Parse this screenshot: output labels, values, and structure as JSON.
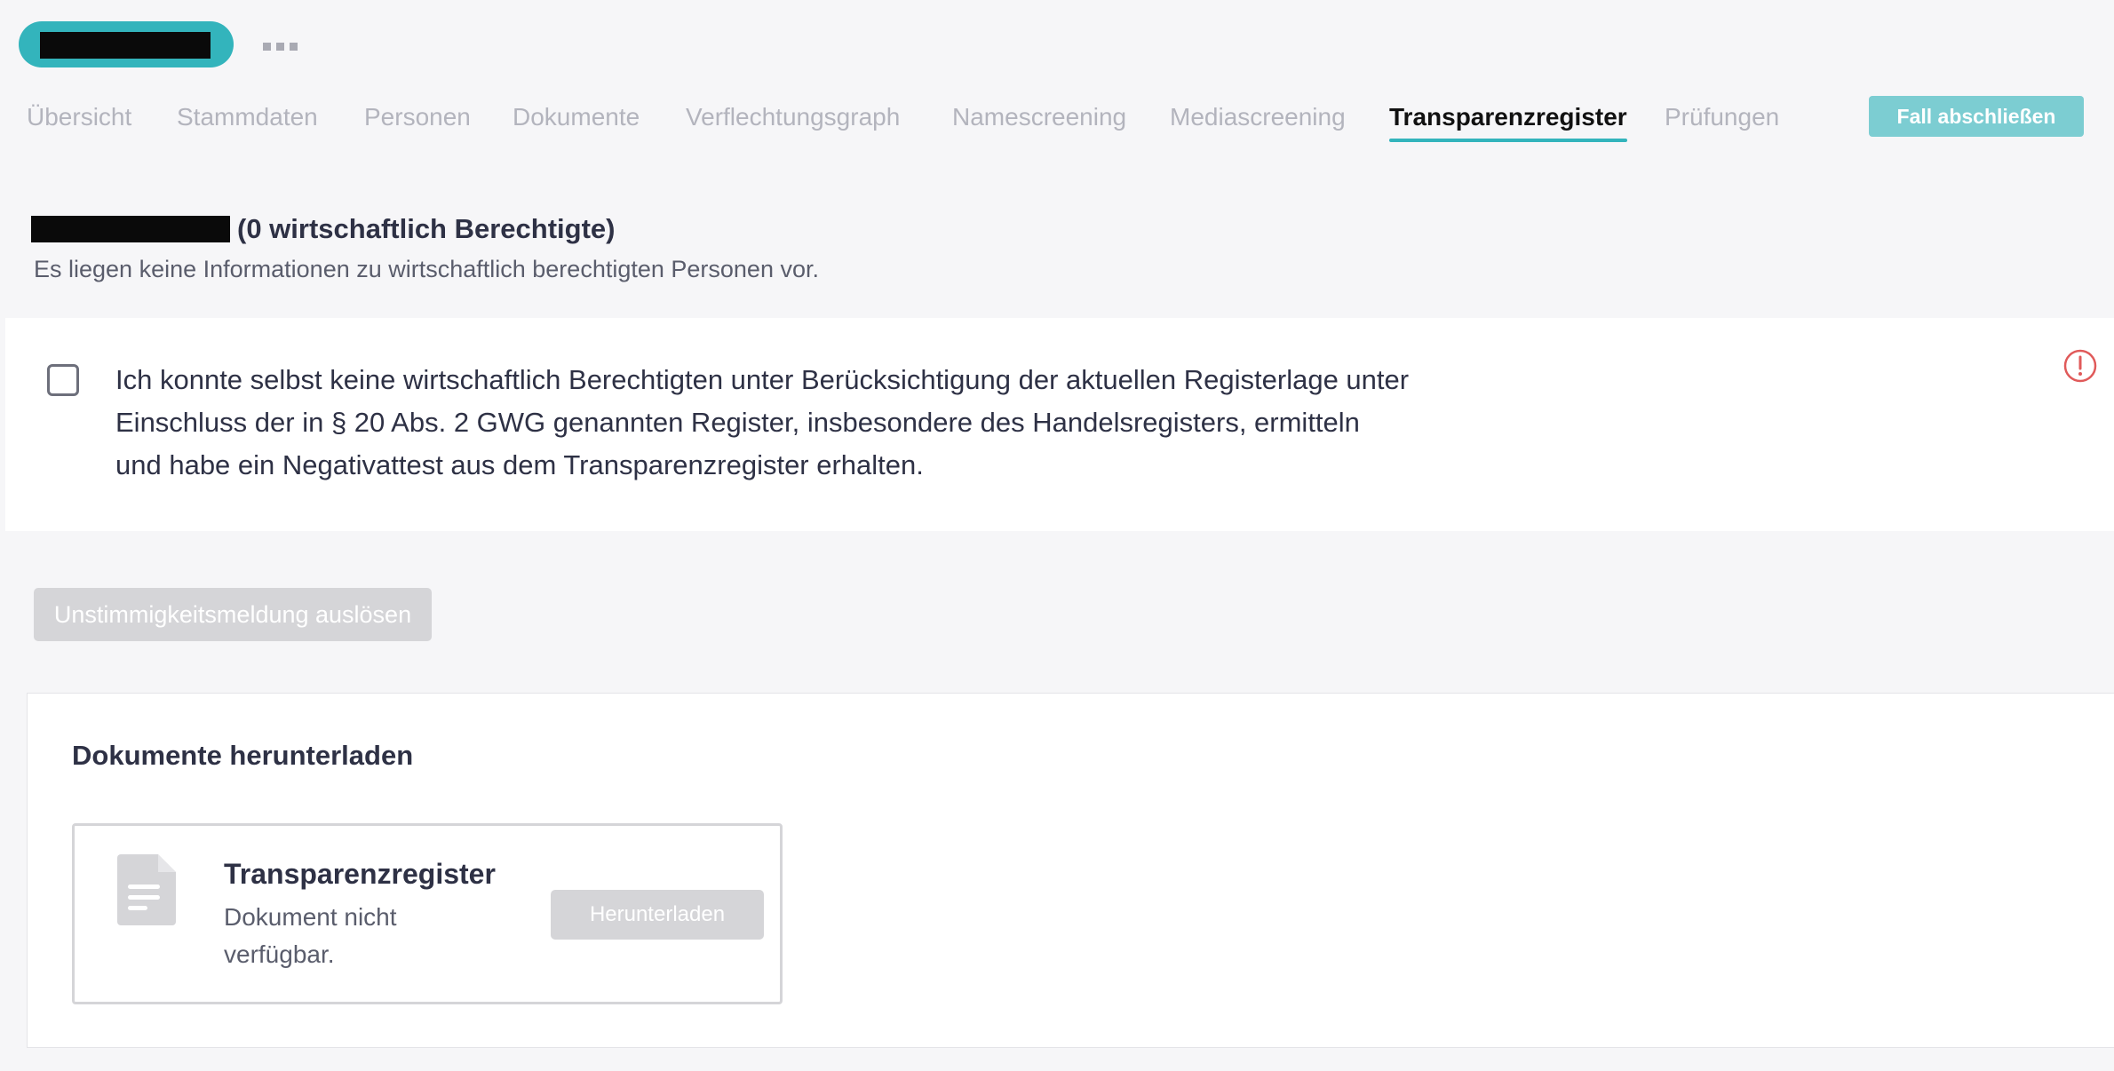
{
  "header": {
    "case_name_redacted": "",
    "more_label": "..."
  },
  "tabs": [
    {
      "label": "Übersicht",
      "active": false
    },
    {
      "label": "Stammdaten",
      "active": false
    },
    {
      "label": "Personen",
      "active": false
    },
    {
      "label": "Dokumente",
      "active": false
    },
    {
      "label": "Verflechtungsgraph",
      "active": false
    },
    {
      "label": "Namescreening",
      "active": false
    },
    {
      "label": "Mediascreening",
      "active": false
    },
    {
      "label": "Transparenzregister",
      "active": true
    },
    {
      "label": "Prüfungen",
      "active": false
    }
  ],
  "actions": {
    "close_case_label": "Fall abschließen"
  },
  "beneficial_owners": {
    "count_label": "(0 wirtschaftlich Berechtigte)",
    "info": "Es liegen keine Informationen zu wirtschaftlich berechtigten Personen vor."
  },
  "confirmation": {
    "checked": false,
    "text": "Ich konnte selbst keine wirtschaftlich Berechtigten unter Berücksichtigung der aktuellen Registerlage unter Einschluss der in § 20 Abs. 2 GWG genannten Register, insbesondere des Handelsregisters, ermitteln und habe ein Negativattest aus dem Transparenzregister erhalten."
  },
  "discrepancy": {
    "button_label": "Unstimmigkeitsmeldung auslösen"
  },
  "documents": {
    "title": "Dokumente herunterladen",
    "items": [
      {
        "name": "Transparenzregister",
        "status": "Dokument nicht verfügbar.",
        "button_label": "Herunterladen"
      }
    ]
  },
  "colors": {
    "accent": "#33b4bc",
    "accent_light": "#7ccdd2",
    "disabled": "#d5d5d8",
    "alert": "#e05a5a"
  }
}
